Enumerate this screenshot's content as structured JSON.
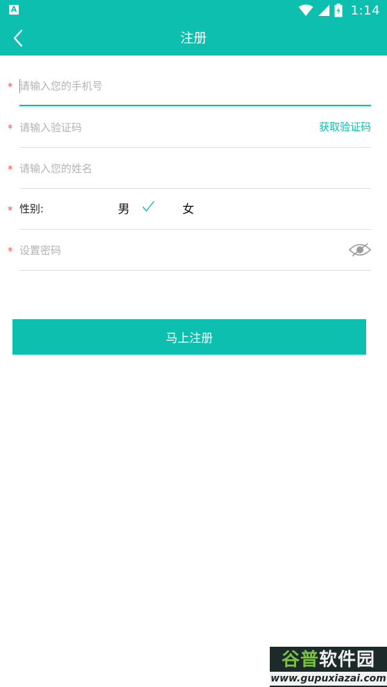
{
  "status_bar": {
    "time": "1:14",
    "left_icon": "A"
  },
  "app_bar": {
    "title": "注册",
    "back_icon": "chevron-left-icon"
  },
  "form": {
    "phone": {
      "required_mark": "*",
      "placeholder": "请输入您的手机号",
      "value": ""
    },
    "code": {
      "required_mark": "*",
      "placeholder": "请输入验证码",
      "value": "",
      "get_code_label": "获取验证码"
    },
    "name": {
      "required_mark": "*",
      "placeholder": "请输入您的姓名",
      "value": ""
    },
    "gender": {
      "required_mark": "*",
      "label": "性别:",
      "options": [
        "男",
        "女"
      ],
      "selected": "男"
    },
    "password": {
      "required_mark": "*",
      "placeholder": "设置密码",
      "value": "",
      "toggle_icon": "eye-icon"
    }
  },
  "submit_label": "马上注册",
  "watermark": {
    "title_part1": "谷普",
    "title_part2": "软件园",
    "url": "www.gupuxiazai.com"
  },
  "colors": {
    "accent": "#0dbfae",
    "required": "#e85a4f",
    "placeholder": "#b3b3b3",
    "divider": "#dedede"
  }
}
